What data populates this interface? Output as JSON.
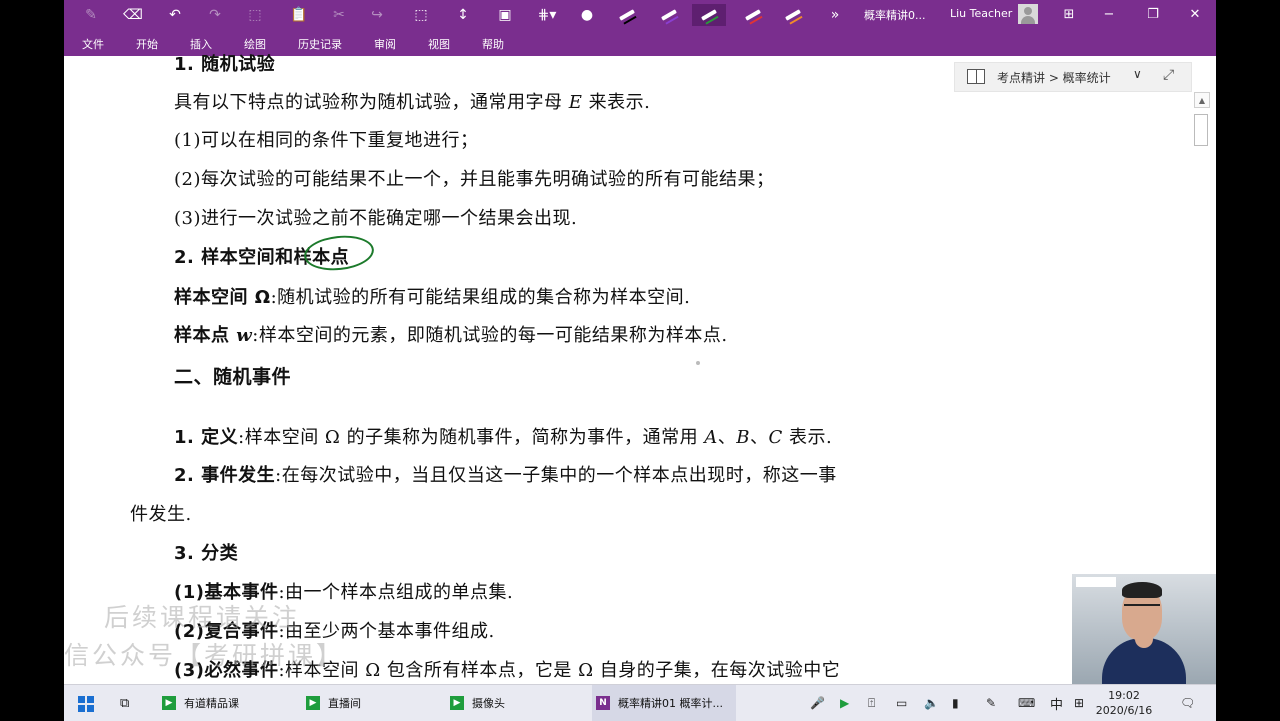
{
  "window": {
    "doc_title": "概率精讲0...",
    "user_name": "Liu Teacher",
    "minimize": "−",
    "restore": "❐",
    "close": "✕",
    "mode": "⊞"
  },
  "ribbon": {
    "tabs": [
      "文件",
      "开始",
      "插入",
      "绘图",
      "历史记录",
      "审阅",
      "视图",
      "帮助"
    ],
    "more": "»"
  },
  "nav": {
    "breadcrumb": "考点精讲 > 概率统计",
    "chevron": "∨",
    "expand": "⤢"
  },
  "content": {
    "l1": "1. 随机试验",
    "l2a": "具有以下特点的试验称为随机试验，通常用字母 ",
    "l2v": "E",
    "l2b": " 来表示.",
    "l3": "(1)可以在相同的条件下重复地进行；",
    "l4": "(2)每次试验的可能结果不止一个，并且能事先明确试验的所有可能结果；",
    "l5": "(3)进行一次试验之前不能确定哪一个结果会出现.",
    "l6": "2. 样本空间和样本点",
    "l7b": "样本空间 Ω",
    "l7": ":随机试验的所有可能结果组成的集合称为样本空间.",
    "l8b": "样本点 ",
    "l8v": "w",
    "l8": ":样本空间的元素，即随机试验的每一可能结果称为样本点.",
    "l9": "二、随机事件",
    "l10b": "1. 定义",
    "l10a": ":样本空间 Ω 的子集称为随机事件，简称为事件，通常用 ",
    "l10v": "A",
    "l10c": "、",
    "l10v2": "B",
    "l10d": "、",
    "l10v3": "C",
    "l10e": " 表示.",
    "l11b": "2. 事件发生",
    "l11": ":在每次试验中，当且仅当这一子集中的一个样本点出现时，称这一事",
    "l12": "件发生.",
    "l13": "3. 分类",
    "l14b": "(1)基本事件",
    "l14": ":由一个样本点组成的单点集.",
    "l15b": "(2)复合事件",
    "l15": ":由至少两个基本事件组成.",
    "l16b": "(3)必然事件",
    "l16": ":样本空间 Ω 包含所有样本点，它是 Ω 自身的子集，在每次试验中它"
  },
  "watermark": {
    "line1": "后续课程请关注",
    "line2": "微信公众号【考研拼课】"
  },
  "taskbar": {
    "apps": [
      {
        "label": "有道精品课",
        "icon": "▶"
      },
      {
        "label": "直播间",
        "icon": "▶"
      },
      {
        "label": "摄像头",
        "icon": "▶"
      },
      {
        "label": "概率精讲01  概率计...",
        "icon": "N"
      }
    ],
    "ime": "中",
    "time": "19:02",
    "date": "2020/6/16"
  }
}
